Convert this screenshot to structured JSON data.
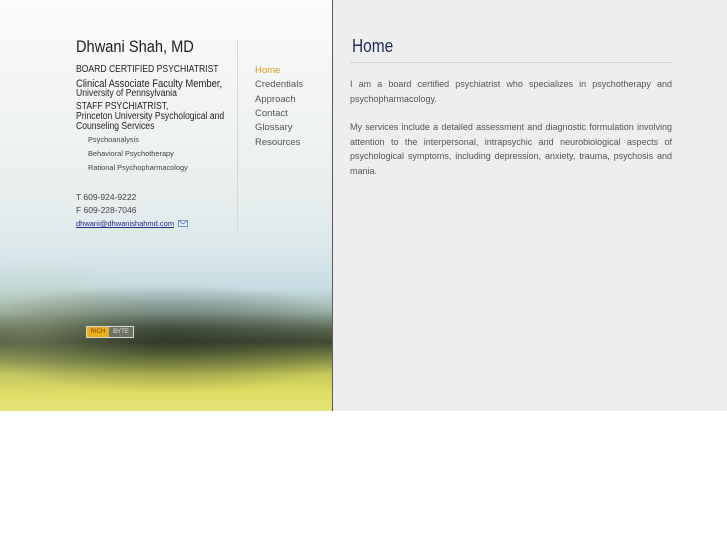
{
  "sidebar": {
    "name": "Dhwani Shah, MD",
    "credentials": {
      "board": "BOARD CERTIFIED PSYCHIATRIST",
      "faculty_line1": "Clinical Associate Faculty Member,",
      "faculty_line2": "University of Pennsylvania",
      "staff_line1": "STAFF PSYCHIATRIST,",
      "staff_line2": "Princeton University Psychological and",
      "staff_line3": "Counseling Services"
    },
    "specialties": [
      "Psychoanalysis",
      "Behavioral Psychotherapy",
      "Rational Psychopharmacology"
    ],
    "phone": "T  609-924-9222",
    "fax": "F  609-228-7046",
    "email": "dhwani@dhwanishahmd.com"
  },
  "nav": {
    "items": [
      "Home",
      "Credentials",
      "Approach",
      "Contact",
      "Glossary",
      "Resources"
    ],
    "active": "Home",
    "active_color": "#e0961c"
  },
  "badge": {
    "left": "RICH",
    "right": "BYTE"
  },
  "main": {
    "title": "Home",
    "paragraphs": [
      "I am a board certified psychiatrist who specializes in psychotherapy and psychopharmacology.",
      "My services include a detailed assessment and diagnostic formulation involving attention to the interpersonal, intrapsychic and neurobiological aspects of psychological symptoms, including depression, anxiety, trauma, psychosis and mania."
    ]
  },
  "icons": {
    "email": "envelope-icon"
  }
}
